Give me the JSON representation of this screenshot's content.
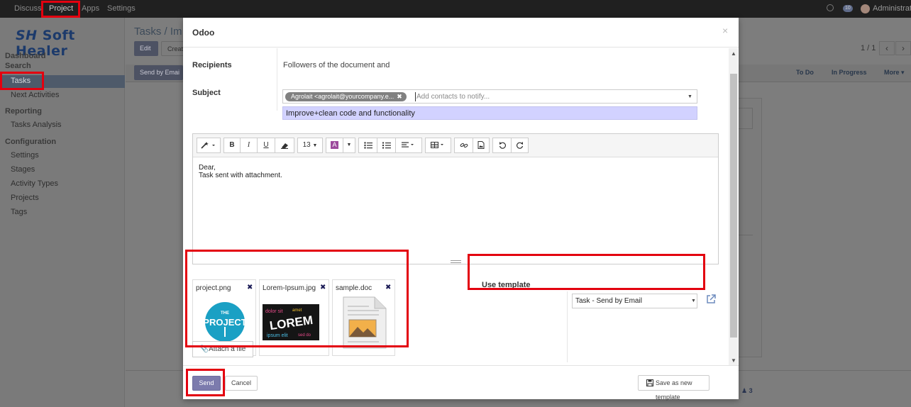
{
  "topbar": {
    "menus": [
      "Discuss",
      "Project",
      "Apps",
      "Settings"
    ],
    "message_count": "10",
    "user": "Administrat"
  },
  "sidebar": {
    "logo": "Soft Healer",
    "logo_mark": "SH",
    "section_dashboard": "Dashboard",
    "section_search": "Search",
    "items_search": [
      "Tasks",
      "Next Activities"
    ],
    "section_reporting": "Reporting",
    "items_reporting": [
      "Tasks Analysis"
    ],
    "section_configuration": "Configuration",
    "items_configuration": [
      "Settings",
      "Stages",
      "Activity Types",
      "Projects",
      "Tags"
    ]
  },
  "background": {
    "breadcrumb": "Tasks /  Im",
    "edit": "Edit",
    "create": "Creat",
    "send_by_email": "Send by Emai",
    "pager": "1 / 1",
    "stages": [
      "To Do",
      "In Progress",
      "More ▾"
    ],
    "followers": "3"
  },
  "modal": {
    "title": "Odoo",
    "close": "×",
    "recipients_label": "Recipients",
    "followers_text": "Followers of the document and",
    "recipient_tag": "Agrolait <agrolait@yourcompany.e...",
    "recipients_placeholder": "Add contacts to notify...",
    "subject_label": "Subject",
    "subject_value": "Improve+clean code and functionality",
    "toolbar": {
      "font_size": "13",
      "bold": "B",
      "italic": "I",
      "underline": "U"
    },
    "body_lines": [
      "Dear,",
      "Task sent with attachment."
    ],
    "attachments": [
      {
        "name": "project.png"
      },
      {
        "name": "Lorem-Ipsum.jpg"
      },
      {
        "name": "sample.doc"
      }
    ],
    "attach_file": "Attach a file",
    "use_template_label": "Use template",
    "template_value": "Task - Send by Email",
    "send": "Send",
    "cancel": "Cancel",
    "save_template": "Save as new template"
  },
  "colors": {
    "highlight": "#e3000f",
    "send_button": "#7c7bad",
    "subject_bg": "#d2d2ff",
    "project_logo": "#1aa0c4"
  }
}
